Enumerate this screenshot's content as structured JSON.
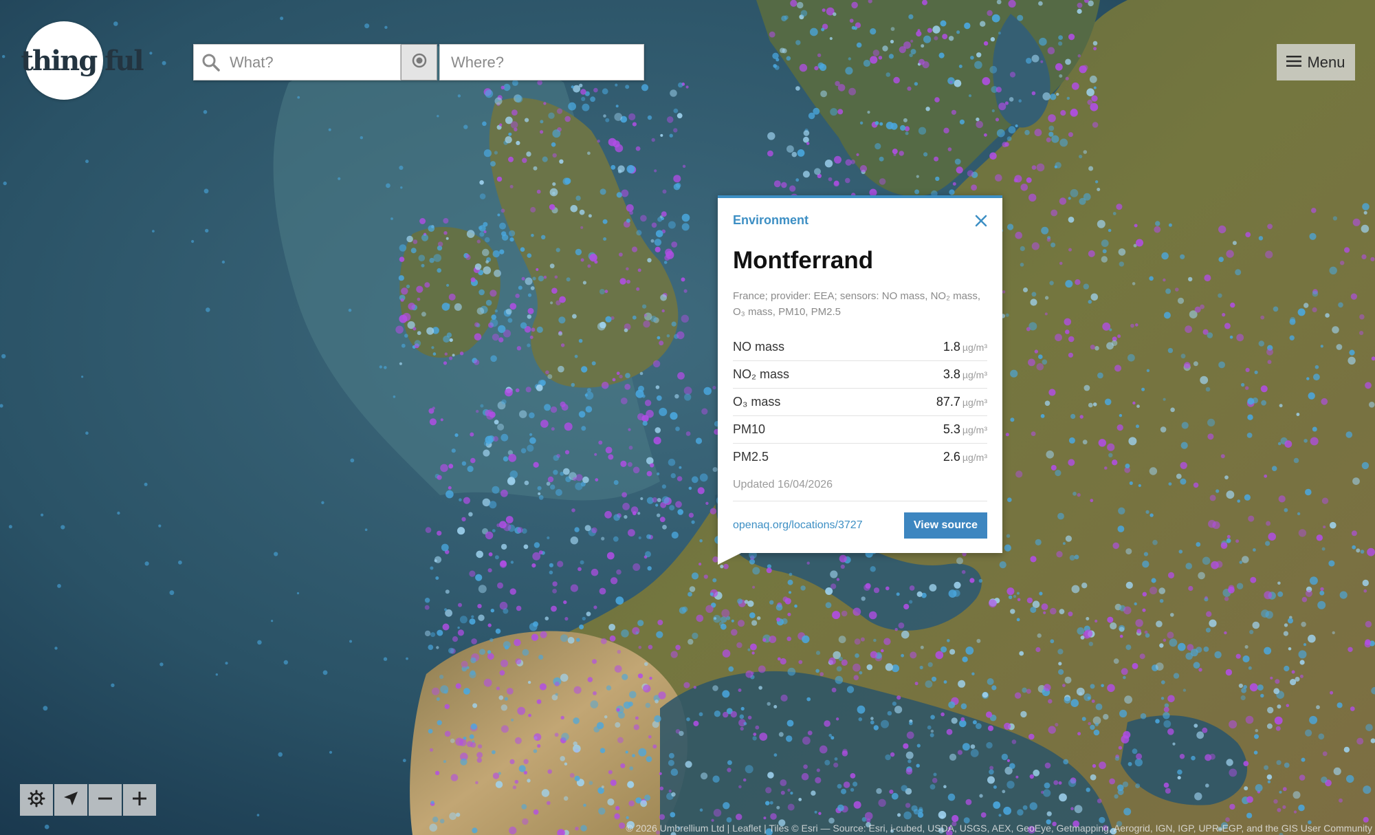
{
  "app": {
    "logo_text": "thing ful"
  },
  "search": {
    "what_placeholder": "What?",
    "where_placeholder": "Where?"
  },
  "menu": {
    "label": "Menu"
  },
  "popup": {
    "category": "Environment",
    "title": "Montferrand",
    "description": "France; provider: EEA; sensors: NO mass, NO₂ mass, O₃ mass, PM10, PM2.5",
    "readings": [
      {
        "name": "NO mass",
        "value": "1.8",
        "unit": "µg/m³"
      },
      {
        "name": "NO₂ mass",
        "value": "3.8",
        "unit": "µg/m³"
      },
      {
        "name": "O₃ mass",
        "value": "87.7",
        "unit": "µg/m³"
      },
      {
        "name": "PM10",
        "value": "5.3",
        "unit": "µg/m³"
      },
      {
        "name": "PM2.5",
        "value": "2.6",
        "unit": "µg/m³"
      }
    ],
    "updated": "Updated 16/04/2026",
    "source_link": "openaq.org/locations/3727",
    "view_source_label": "View source"
  },
  "attribution": "© 2026 Umbrellium Ltd | Leaflet | Tiles © Esri — Source: Esri, i-cubed, USDA, USGS, AEX, GeoEye, Getmapping, Aerogrid, IGN, IGP, UPR-EGP, and the GIS User Community",
  "colors": {
    "accent": "#3d8fc4",
    "ocean": "#1e4257",
    "land": "#6e7448",
    "marker_blue": "#4aa8e0",
    "marker_purple": "#b24de6"
  },
  "icons": {
    "search": "search-icon",
    "locate": "target-icon",
    "menu": "hamburger-icon",
    "close": "close-icon",
    "settings": "gear-icon",
    "navigate": "navigation-arrow-icon",
    "zoom_out": "minus-icon",
    "zoom_in": "plus-icon"
  }
}
